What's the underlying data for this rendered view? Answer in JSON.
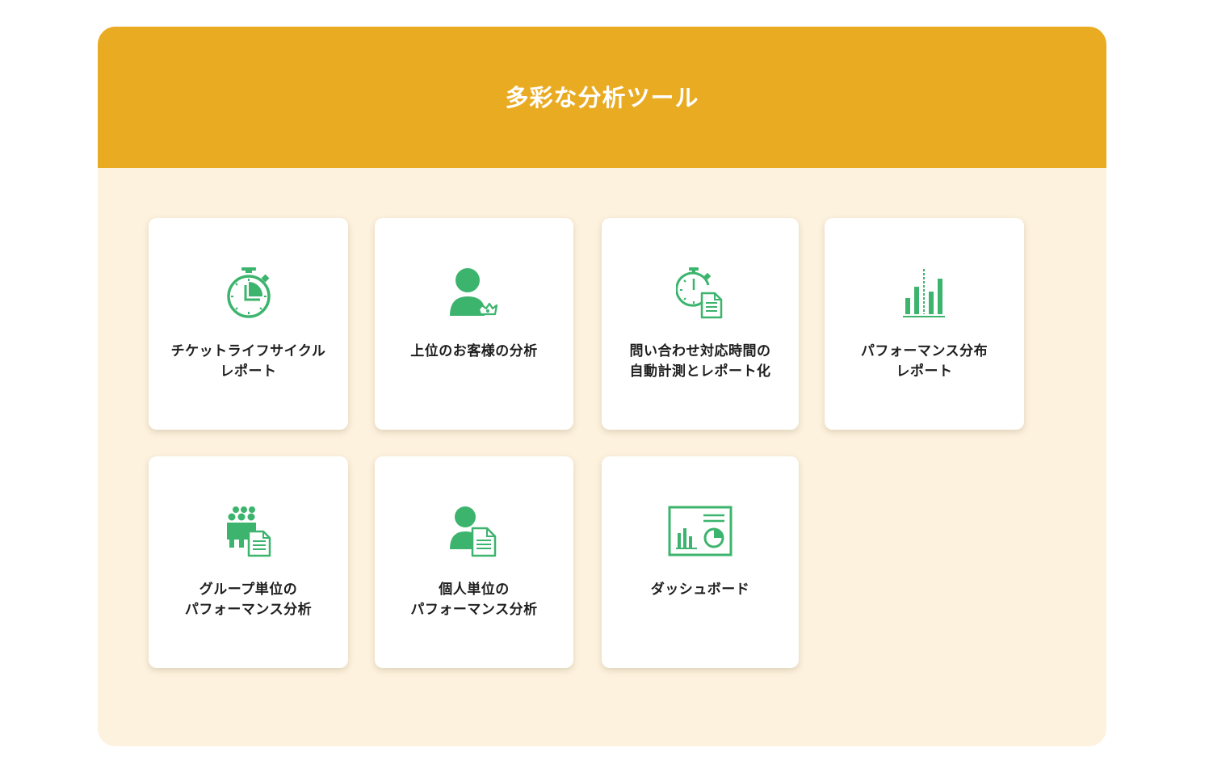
{
  "header": {
    "title": "多彩な分析ツール"
  },
  "colors": {
    "header_bg": "#e9ab22",
    "panel_bg": "#fdf2de",
    "icon_green": "#3cb46e"
  },
  "cards": [
    {
      "label": "チケットライフサイクル\nレポート",
      "icon": "stopwatch-icon"
    },
    {
      "label": "上位のお客様の分析",
      "icon": "customer-crown-icon"
    },
    {
      "label": "問い合わせ対応時間の\n自動計測とレポート化",
      "icon": "timer-document-icon"
    },
    {
      "label": "パフォーマンス分布\nレポート",
      "icon": "bar-chart-icon"
    },
    {
      "label": "グループ単位の\nパフォーマンス分析",
      "icon": "group-document-icon"
    },
    {
      "label": "個人単位の\nパフォーマンス分析",
      "icon": "person-document-icon"
    },
    {
      "label": "ダッシュボード",
      "icon": "dashboard-icon"
    }
  ]
}
